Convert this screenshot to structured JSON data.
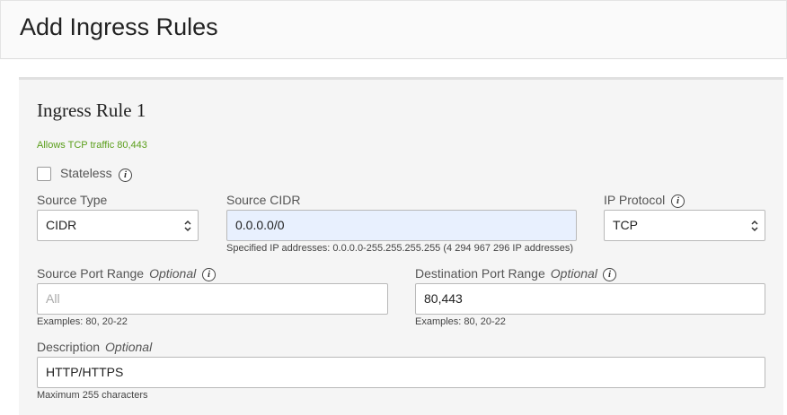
{
  "header": {
    "title": "Add Ingress Rules"
  },
  "rule": {
    "title": "Ingress Rule 1",
    "summary": "Allows TCP traffic 80,443",
    "stateless": {
      "label": "Stateless",
      "checked": false
    }
  },
  "source_type": {
    "label": "Source Type",
    "value": "CIDR"
  },
  "source_cidr": {
    "label": "Source CIDR",
    "value": "0.0.0.0/0",
    "help": "Specified IP addresses: 0.0.0.0-255.255.255.255 (4 294 967 296 IP addresses)"
  },
  "ip_protocol": {
    "label": "IP Protocol",
    "value": "TCP"
  },
  "source_port": {
    "label": "Source Port Range",
    "optional": "Optional",
    "placeholder": "All",
    "help": "Examples: 80, 20-22"
  },
  "dest_port": {
    "label": "Destination Port Range",
    "optional": "Optional",
    "value": "80,443",
    "help": "Examples: 80, 20-22"
  },
  "description": {
    "label": "Description",
    "optional": "Optional",
    "value": "HTTP/HTTPS",
    "help": "Maximum 255 characters"
  },
  "colors": {
    "summary_text": "#5a9e1a",
    "highlight_field": "#e8f0fe",
    "panel_bg": "#f5f5f5"
  },
  "icons": {
    "info": "info-icon",
    "select": "select-arrows-icon"
  }
}
